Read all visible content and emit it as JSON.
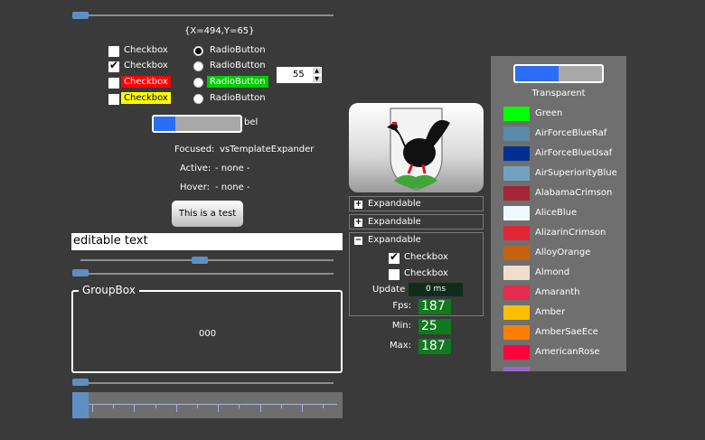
{
  "coords_label": "{X=494,Y=65}",
  "checkboxes": [
    {
      "label": "Checkbox",
      "checked": false
    },
    {
      "label": "Checkbox",
      "checked": true
    },
    {
      "label": "Checkbox",
      "checked": false,
      "highlight": "#ff0000"
    },
    {
      "label": "Checkbox",
      "checked": false,
      "highlight": "#ffff00"
    }
  ],
  "radios": [
    {
      "label": "RadioButton",
      "checked": true
    },
    {
      "label": "RadioButton",
      "checked": false
    },
    {
      "label": "RadioButton",
      "checked": false,
      "highlight": "#00cc00"
    },
    {
      "label": "RadioButton",
      "checked": false
    }
  ],
  "spinner": {
    "value": "55"
  },
  "progress_label": "bel",
  "progress_fraction": 0.25,
  "focus_info": {
    "focused_label": "Focused:",
    "focused_value": "vsTemplateExpander",
    "active_label": "Active:",
    "active_value": "- none -",
    "hover_label": "Hover:",
    "hover_value": "- none -"
  },
  "test_button": "This is a test",
  "editable_text": "editable text",
  "groupbox": {
    "title": "GroupBox",
    "content": "000"
  },
  "sliders": {
    "top": 0.0,
    "mid": 0.47,
    "second": 0.0,
    "bottom": 0.0,
    "big": 0.0
  },
  "expanders": [
    {
      "label": "Expandable",
      "expanded": false
    },
    {
      "label": "Expandable",
      "expanded": false
    },
    {
      "label": "Expandable",
      "expanded": true,
      "children": [
        {
          "label": "Checkbox",
          "checked": true
        },
        {
          "label": "Checkbox",
          "checked": false
        }
      ]
    }
  ],
  "update": {
    "label": "Update",
    "value": "0 ms"
  },
  "stats": [
    {
      "label": "Fps:",
      "value": "187"
    },
    {
      "label": "Min:",
      "value": "25"
    },
    {
      "label": "Max:",
      "value": "187"
    }
  ],
  "palette": {
    "progress_fraction": 0.5,
    "title": "Transparent",
    "colors": [
      {
        "name": "Green",
        "hex": "#00ff00"
      },
      {
        "name": "AirForceBlueRaf",
        "hex": "#5d8aa8"
      },
      {
        "name": "AirForceBlueUsaf",
        "hex": "#00308f"
      },
      {
        "name": "AirSuperiorityBlue",
        "hex": "#72a0c1"
      },
      {
        "name": "AlabamaCrimson",
        "hex": "#a32638"
      },
      {
        "name": "AliceBlue",
        "hex": "#f0f8ff"
      },
      {
        "name": "AlizarinCrimson",
        "hex": "#e32636"
      },
      {
        "name": "AlloyOrange",
        "hex": "#c46210"
      },
      {
        "name": "Almond",
        "hex": "#efdecd"
      },
      {
        "name": "Amaranth",
        "hex": "#e52b50"
      },
      {
        "name": "Amber",
        "hex": "#ffbf00"
      },
      {
        "name": "AmberSaeEce",
        "hex": "#ff7e00"
      },
      {
        "name": "AmericanRose",
        "hex": "#ff033e"
      }
    ]
  }
}
